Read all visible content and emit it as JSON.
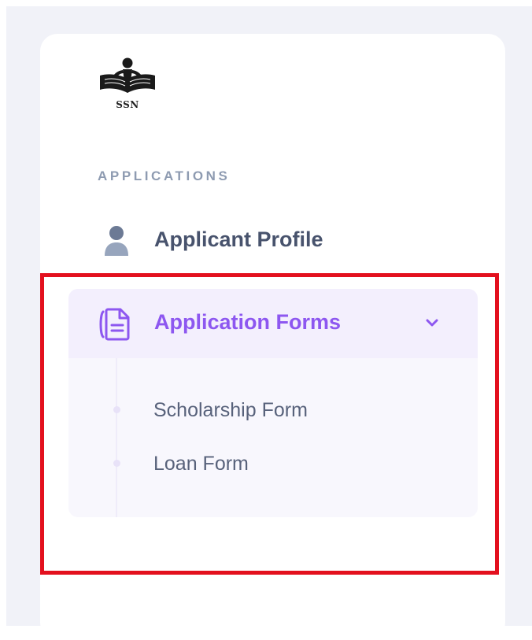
{
  "logo": {
    "text": "SSN",
    "icon": "reader-book-logo-icon"
  },
  "sidebar": {
    "section_heading": "APPLICATIONS",
    "applicant_profile": {
      "label": "Applicant Profile",
      "icon": "user-icon"
    },
    "application_forms": {
      "label": "Application Forms",
      "icon": "document-icon",
      "chevron": "chevron-down-icon",
      "expanded": true,
      "items": [
        {
          "label": "Scholarship Form"
        },
        {
          "label": "Loan Form"
        }
      ]
    }
  },
  "colors": {
    "accent": "#8d57f0",
    "active_bg": "#f3effd",
    "submenu_bg": "#f8f7fd",
    "text_primary": "#48536d",
    "heading": "#8e9bb1",
    "highlight_border": "#e3101e",
    "page_bg": "#f1f2f8"
  }
}
